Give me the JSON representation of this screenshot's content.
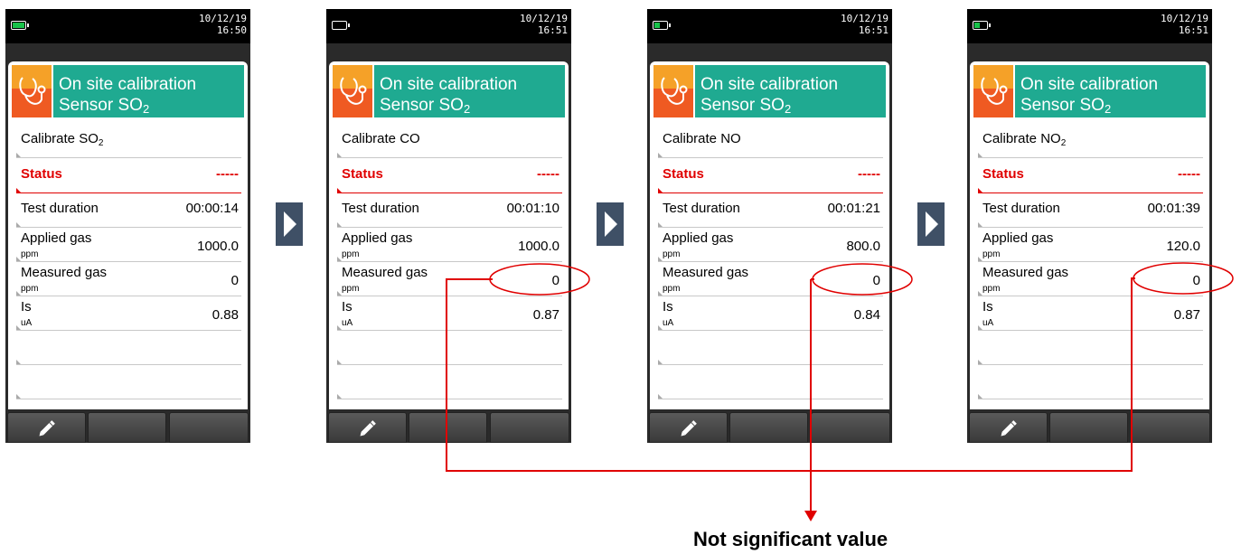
{
  "screens": [
    {
      "time_line1": "10/12/19",
      "time_line2": "16:50",
      "battery": "full",
      "title_line1": "On site calibration",
      "title_line2_prefix": "Sensor SO",
      "title_line2_sub": "2",
      "calibrate_prefix": "Calibrate SO",
      "calibrate_sub": "2",
      "status_label": "Status",
      "status_value": "-----",
      "test_duration_label": "Test duration",
      "test_duration_value": "00:00:14",
      "applied_gas_label": "Applied gas",
      "applied_gas_unit": "ppm",
      "applied_gas_value": "1000.0",
      "measured_gas_label": "Measured gas",
      "measured_gas_unit": "ppm",
      "measured_gas_value": "0",
      "is_label": "Is",
      "is_unit": "uA",
      "is_value": "0.88"
    },
    {
      "time_line1": "10/12/19",
      "time_line2": "16:51",
      "battery": "low",
      "title_line1": "On site calibration",
      "title_line2_prefix": "Sensor SO",
      "title_line2_sub": "2",
      "calibrate_prefix": "Calibrate CO",
      "calibrate_sub": "",
      "status_label": "Status",
      "status_value": "-----",
      "test_duration_label": "Test duration",
      "test_duration_value": "00:01:10",
      "applied_gas_label": "Applied gas",
      "applied_gas_unit": "ppm",
      "applied_gas_value": "1000.0",
      "measured_gas_label": "Measured gas",
      "measured_gas_unit": "ppm",
      "measured_gas_value": "0",
      "is_label": "Is",
      "is_unit": "uA",
      "is_value": "0.87"
    },
    {
      "time_line1": "10/12/19",
      "time_line2": "16:51",
      "battery": "mid",
      "title_line1": "On site calibration",
      "title_line2_prefix": "Sensor SO",
      "title_line2_sub": "2",
      "calibrate_prefix": "Calibrate NO",
      "calibrate_sub": "",
      "status_label": "Status",
      "status_value": "-----",
      "test_duration_label": "Test duration",
      "test_duration_value": "00:01:21",
      "applied_gas_label": "Applied gas",
      "applied_gas_unit": "ppm",
      "applied_gas_value": "800.0",
      "measured_gas_label": "Measured gas",
      "measured_gas_unit": "ppm",
      "measured_gas_value": "0",
      "is_label": "Is",
      "is_unit": "uA",
      "is_value": "0.84"
    },
    {
      "time_line1": "10/12/19",
      "time_line2": "16:51",
      "battery": "mid",
      "title_line1": "On site calibration",
      "title_line2_prefix": "Sensor SO",
      "title_line2_sub": "2",
      "calibrate_prefix": "Calibrate NO",
      "calibrate_sub": "2",
      "status_label": "Status",
      "status_value": "-----",
      "test_duration_label": "Test duration",
      "test_duration_value": "00:01:39",
      "applied_gas_label": "Applied gas",
      "applied_gas_unit": "ppm",
      "applied_gas_value": "120.0",
      "measured_gas_label": "Measured gas",
      "measured_gas_unit": "ppm",
      "measured_gas_value": "0",
      "is_label": "Is",
      "is_unit": "uA",
      "is_value": "0.87"
    }
  ],
  "softkeys": {
    "edit_icon": "pencil-icon"
  },
  "annotation": {
    "note": "Not significant value",
    "color": "#e00000"
  },
  "colors": {
    "header_teal": "#1faa91",
    "icon_orange": "#ef5a22",
    "icon_yellow": "#f5a128",
    "arrow": "#3f5066",
    "status_red": "#e00000"
  }
}
